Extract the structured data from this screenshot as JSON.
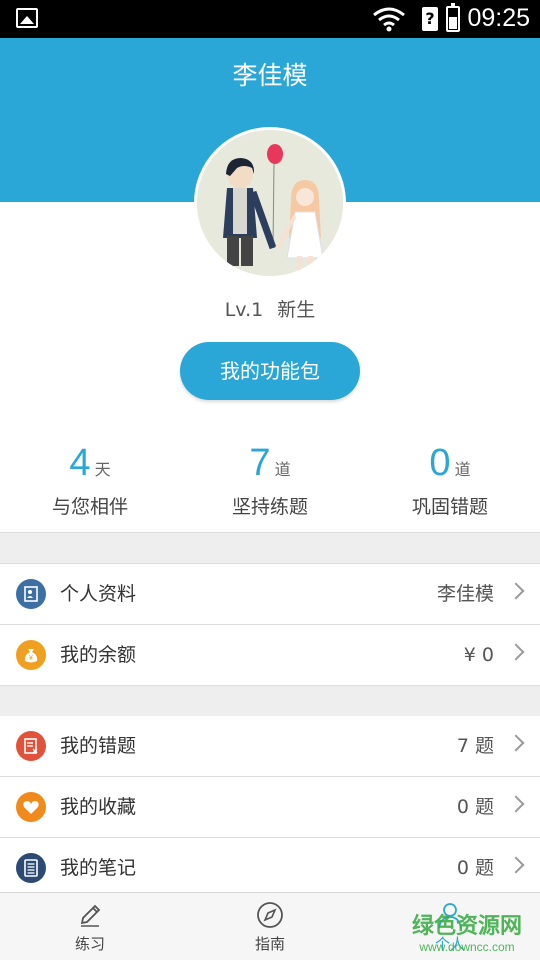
{
  "status_bar": {
    "time": "09:25",
    "sim_label": "?",
    "icons": [
      "gallery-icon",
      "wifi-icon",
      "sim-icon",
      "battery-icon"
    ]
  },
  "header": {
    "title": "李佳模",
    "color": "#2aa7d7"
  },
  "profile": {
    "level": "Lv.1",
    "rank": "新生",
    "feature_button": "我的功能包"
  },
  "stats": [
    {
      "value": "4",
      "unit": "天",
      "caption": "与您相伴"
    },
    {
      "value": "7",
      "unit": "道",
      "caption": "坚持练题"
    },
    {
      "value": "0",
      "unit": "道",
      "caption": "巩固错题"
    }
  ],
  "account_rows": [
    {
      "icon": "profile-card-icon",
      "label": "个人资料",
      "value": "李佳模",
      "color": "#3e6fa3"
    },
    {
      "icon": "money-bag-icon",
      "label": "我的余额",
      "value": "¥ 0",
      "color": "#f0a020"
    }
  ],
  "study_rows": [
    {
      "icon": "wrong-question-icon",
      "label": "我的错题",
      "value": "7 题",
      "color": "#e0523a"
    },
    {
      "icon": "heart-icon",
      "label": "我的收藏",
      "value": "0 题",
      "color": "#f08a1c"
    },
    {
      "icon": "notebook-icon",
      "label": "我的笔记",
      "value": "0 题",
      "color": "#2d4a73"
    }
  ],
  "bottom_nav": [
    {
      "icon": "pencil-icon",
      "label": "练习"
    },
    {
      "icon": "compass-icon",
      "label": "指南"
    },
    {
      "icon": "person-icon",
      "label": "个人"
    }
  ],
  "watermark": {
    "main": "绿色资源网",
    "sub": "www.downcc.com"
  }
}
